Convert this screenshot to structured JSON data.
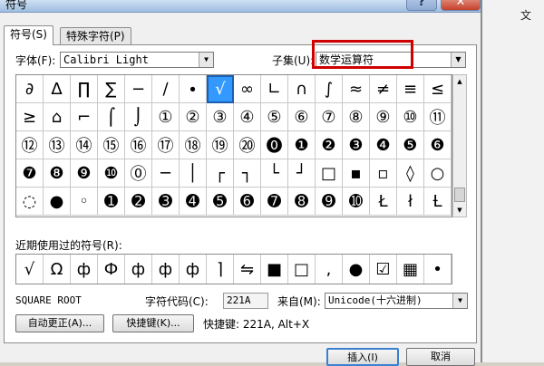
{
  "window": {
    "title": "符号",
    "help_label": "?",
    "close_label": "✕"
  },
  "background_app": {
    "label": "文"
  },
  "tabs": [
    {
      "label": "符号(S)"
    },
    {
      "label": "特殊字符(P)"
    }
  ],
  "font": {
    "label": "字体(F):",
    "value": "Calibri Light"
  },
  "subset": {
    "label": "子集(U):",
    "value": "数学运算符"
  },
  "symbols": [
    "∂",
    "∆",
    "∏",
    "∑",
    "−",
    "∕",
    "∙",
    "√",
    "∞",
    "∟",
    "∩",
    "∫",
    "≈",
    "≠",
    "≡",
    "≤",
    "≥",
    "⌂",
    "⌐",
    "⌠",
    "⌡",
    "①",
    "②",
    "③",
    "④",
    "⑤",
    "⑥",
    "⑦",
    "⑧",
    "⑨",
    "⑩",
    "⑪",
    "⑫",
    "⑬",
    "⑭",
    "⑮",
    "⑯",
    "⑰",
    "⑱",
    "⑲",
    "⑳",
    "⓿",
    "❶",
    "❷",
    "❸",
    "❹",
    "❺",
    "❻",
    "❼",
    "❽",
    "❾",
    "❿",
    "⓪",
    "─",
    "│",
    "┌",
    "┐",
    "└",
    "┘",
    "□",
    "▪",
    "▫",
    "◊",
    "○",
    "◌",
    "●",
    "◦",
    "➊",
    "➋",
    "➌",
    "➍",
    "➎",
    "➏",
    "➐",
    "➑",
    "➒",
    "➓",
    "Ł",
    "ł",
    "Ƚ"
  ],
  "selected_index": 7,
  "recent": {
    "label": "近期使用过的符号(R):",
    "items": [
      "√",
      "Ω",
      "ф",
      "Ф",
      "ф",
      "ф",
      "ф",
      "⌉",
      "⇋",
      "■",
      "□",
      ",",
      "●",
      "☑",
      "▦",
      "•"
    ]
  },
  "char_name": "SQUARE ROOT",
  "char_code": {
    "label": "字符代码(C):",
    "value": "221A"
  },
  "from": {
    "label": "来自(M):",
    "value": "Unicode(十六进制)"
  },
  "buttons": {
    "autocorrect": "自动更正(A)...",
    "shortcut": "快捷键(K)...",
    "insert": "插入(I)",
    "cancel": "取消"
  },
  "shortcut_text": "快捷键: 221A, Alt+X"
}
